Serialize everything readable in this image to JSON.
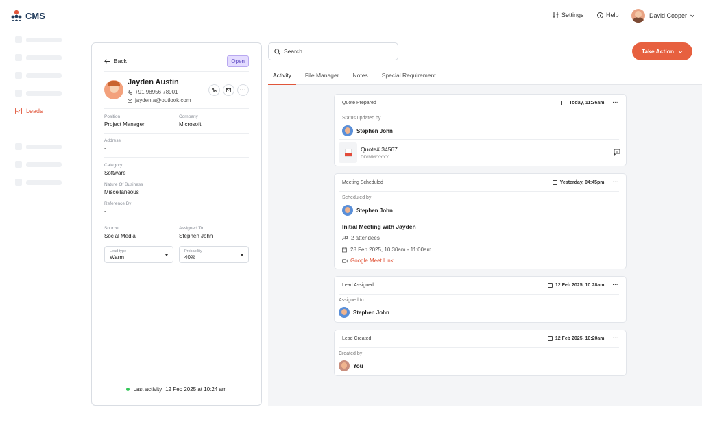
{
  "app": {
    "name": "CMS"
  },
  "header": {
    "settings": "Settings",
    "help": "Help",
    "user": "David Cooper"
  },
  "sidebar": {
    "active_item": "Leads"
  },
  "lead": {
    "back": "Back",
    "status": "Open",
    "name": "Jayden Austin",
    "phone": "+91 98956 78901",
    "email": "jayden.a@outlook.com",
    "position_label": "Position",
    "position": "Project Manager",
    "company_label": "Company",
    "company": "Microsoft",
    "address_label": "Address",
    "address": "-",
    "category_label": "Category",
    "category": "Software",
    "nature_label": "Nature Of Business",
    "nature": "Miscellaneous",
    "reference_label": "Reference By",
    "reference": "-",
    "source_label": "Source",
    "source": "Social Media",
    "assigned_label": "Assigned To",
    "assigned": "Stephen John",
    "leadtype_label": "Lead type",
    "leadtype": "Warm",
    "probability_label": "Probability",
    "probability": "40%",
    "last_activity_label": "Last activity",
    "last_activity": "12 Feb 2025 at 10:24 am"
  },
  "main": {
    "search_placeholder": "Search",
    "take_action": "Take Action",
    "tabs": [
      "Activity",
      "File Manager",
      "Notes",
      "Special Requirement"
    ]
  },
  "activities": [
    {
      "title": "Quote Prepared",
      "date": "Today, 11:36am",
      "sub_label": "Status updated by",
      "person": "Stephen John",
      "quote": "Quote# 34567",
      "quote_date": "DD/MM/YYYY"
    },
    {
      "title": "Meeting Scheduled",
      "date": "Yesterday, 04:45pm",
      "sub_label": "Scheduled by",
      "person": "Stephen John",
      "meeting_title": "Initial Meeting with Jayden",
      "attendees": "2 attendees",
      "when": "28 Feb 2025, 10:30am - 11:00am",
      "link": "Google Meet Link"
    },
    {
      "title": "Lead Assigned",
      "date": "12 Feb 2025, 10:28am",
      "sub_label": "Assigned to",
      "person": "Stephen John"
    },
    {
      "title": "Lead Created",
      "date": "12 Feb 2025, 10:20am",
      "sub_label": "Created by",
      "person": "You"
    }
  ],
  "colors": {
    "accent": "#e7603f",
    "brand": "#1f3a5a",
    "status_open": "#5b47c2",
    "online": "#34c759"
  }
}
